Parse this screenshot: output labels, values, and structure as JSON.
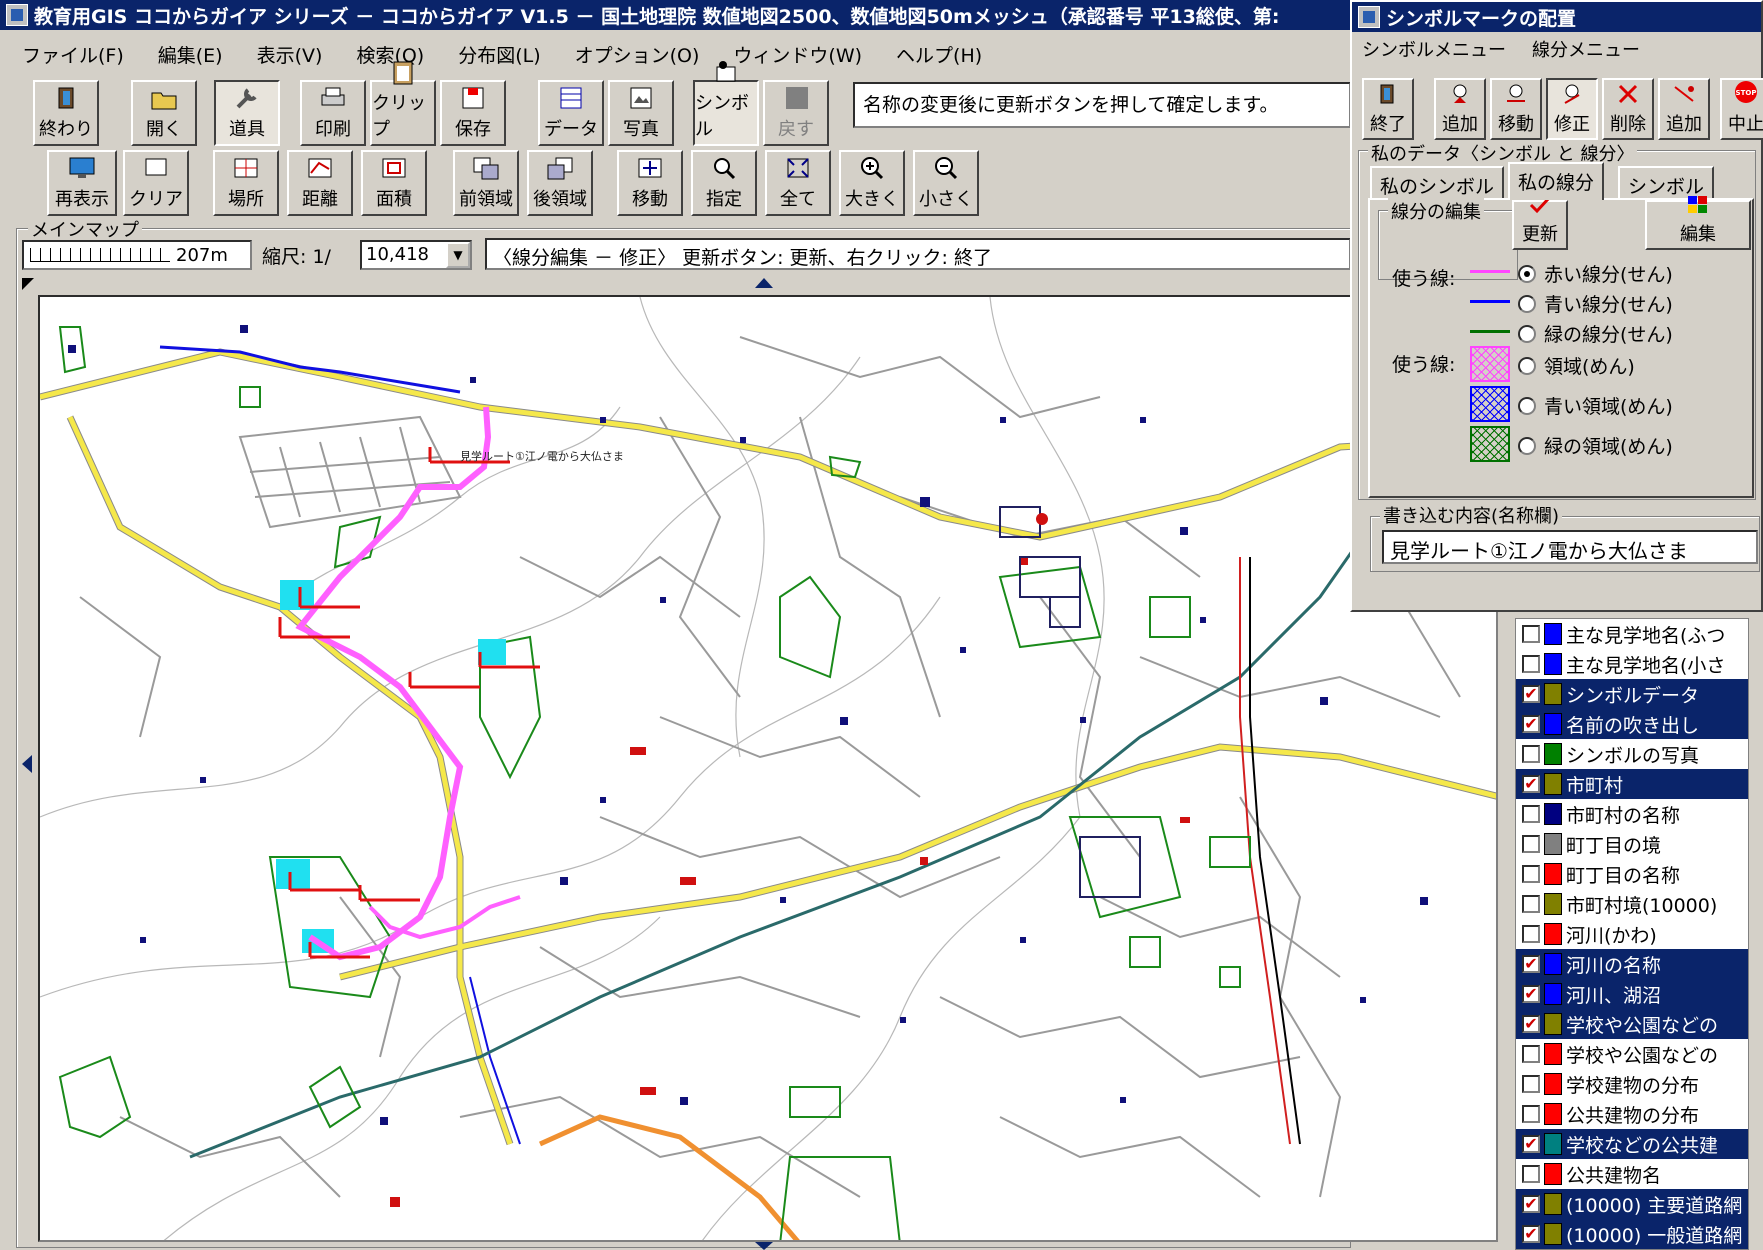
{
  "window": {
    "title": "教育用GIS ココからガイア シリーズ － ココからガイア V1.5 － 国土地理院 数値地図2500、数値地図50mメッシュ（承認番号 平13総使、第:"
  },
  "menu": {
    "items": [
      "ファイル(F)",
      "編集(E)",
      "表示(V)",
      "検索(Q)",
      "分布図(L)",
      "オプション(O)",
      "ウィンドウ(W)",
      "ヘルプ(H)"
    ]
  },
  "toolbar1": {
    "buttons": [
      {
        "label": "終わり",
        "icon": "exit-icon"
      },
      {
        "label": "開く",
        "icon": "open-folder-icon"
      },
      {
        "label": "道具",
        "icon": "tools-icon"
      },
      {
        "label": "印刷",
        "icon": "printer-icon"
      },
      {
        "label": "クリップ",
        "icon": "clipboard-icon"
      },
      {
        "label": "保存",
        "icon": "save-icon"
      },
      {
        "label": "データ",
        "icon": "data-icon"
      },
      {
        "label": "写真",
        "icon": "photo-icon"
      },
      {
        "label": "シンボル",
        "icon": "symbol-icon"
      },
      {
        "label": "戻す",
        "icon": "undo-icon"
      }
    ],
    "message": "名称の変更後に更新ボタンを押して確定します。"
  },
  "toolbar2": {
    "buttons": [
      {
        "label": "再表示",
        "icon": "redraw-icon"
      },
      {
        "label": "クリア",
        "icon": "clear-icon"
      },
      {
        "label": "場所",
        "icon": "location-icon"
      },
      {
        "label": "距離",
        "icon": "distance-icon"
      },
      {
        "label": "面積",
        "icon": "area-icon"
      },
      {
        "label": "前領域",
        "icon": "previous-extent-icon"
      },
      {
        "label": "後領域",
        "icon": "next-extent-icon"
      },
      {
        "label": "移動",
        "icon": "pan-icon"
      },
      {
        "label": "指定",
        "icon": "select-zoom-icon"
      },
      {
        "label": "全て",
        "icon": "full-extent-icon"
      },
      {
        "label": "大きく",
        "icon": "zoom-in-icon"
      },
      {
        "label": "小さく",
        "icon": "zoom-out-icon"
      }
    ]
  },
  "mainmap": {
    "group_label": "メインマップ",
    "scale_text": "207m",
    "scale_label": "縮尺: 1/",
    "scale_value": "10,418",
    "status": "〈線分編集 － 修正〉 更新ボタン: 更新、右クリック: 終了"
  },
  "dialog": {
    "title": "シンボルマークの配置",
    "menu": [
      "シンボルメニュー",
      "線分メニュー"
    ],
    "buttons": [
      {
        "label": "終了",
        "icon": "exit-icon"
      },
      {
        "label": "追加",
        "icon": "add-symbol-icon"
      },
      {
        "label": "移動",
        "icon": "move-symbol-icon"
      },
      {
        "label": "修正",
        "icon": "edit-symbol-icon"
      },
      {
        "label": "削除",
        "icon": "delete-symbol-icon"
      },
      {
        "label": "追加",
        "icon": "add-line-icon"
      },
      {
        "label": "中止",
        "icon": "stop-icon"
      }
    ],
    "data_group_label": "私のデータ〈シンボル と 線分〉",
    "tabs": [
      "私のシンボル",
      "私の線分",
      "シンボル"
    ],
    "active_tab": "私の線分",
    "edit_group_label": "線分の編集",
    "update_label": "更新",
    "edit_label": "編集",
    "use_line_label": "使う線:",
    "use_area_label": "使う線:",
    "line_options": [
      {
        "label": "赤い線分(せん)",
        "color": "#ff44ff",
        "checked": true
      },
      {
        "label": "青い線分(せん)",
        "color": "#0000ff",
        "checked": false
      },
      {
        "label": "緑の線分(せん)",
        "color": "#007000",
        "checked": false
      }
    ],
    "area_options": [
      {
        "label": "領域(めん)",
        "color": "#ff44ff",
        "checked": false
      },
      {
        "label": "青い領域(めん)",
        "color": "#0000ff",
        "checked": false
      },
      {
        "label": "緑の領域(めん)",
        "color": "#007000",
        "checked": false
      }
    ],
    "content_group_label": "書き込む内容(名称欄)",
    "content_value": "見学ルート①江ノ電から大仏さま"
  },
  "layers": [
    {
      "label": "主な見学地名(ふつ",
      "checked": false,
      "color": "#0000ff",
      "selected": false
    },
    {
      "label": "主な見学地名(小さ",
      "checked": false,
      "color": "#0000ff",
      "selected": false
    },
    {
      "label": "シンボルデータ",
      "checked": true,
      "color": "#808000",
      "selected": true
    },
    {
      "label": "名前の吹き出し",
      "checked": true,
      "color": "#0000ff",
      "selected": true
    },
    {
      "label": "シンボルの写真",
      "checked": false,
      "color": "#008000",
      "selected": false
    },
    {
      "label": "市町村",
      "checked": true,
      "color": "#808000",
      "selected": true
    },
    {
      "label": "市町村の名称",
      "checked": false,
      "color": "#000080",
      "selected": false
    },
    {
      "label": "町丁目の境",
      "checked": false,
      "color": "#808080",
      "selected": false
    },
    {
      "label": "町丁目の名称",
      "checked": false,
      "color": "#ff0000",
      "selected": false
    },
    {
      "label": "市町村境(10000)",
      "checked": false,
      "color": "#808000",
      "selected": false
    },
    {
      "label": "河川(かわ)",
      "checked": false,
      "color": "#ff0000",
      "selected": false
    },
    {
      "label": "河川の名称",
      "checked": true,
      "color": "#0000ff",
      "selected": true
    },
    {
      "label": "河川、湖沼",
      "checked": true,
      "color": "#0000ff",
      "selected": true
    },
    {
      "label": "学校や公園などの",
      "checked": true,
      "color": "#808000",
      "selected": true
    },
    {
      "label": "学校や公園などの",
      "checked": false,
      "color": "#ff0000",
      "selected": false
    },
    {
      "label": "学校建物の分布",
      "checked": false,
      "color": "#ff0000",
      "selected": false
    },
    {
      "label": "公共建物の分布",
      "checked": false,
      "color": "#ff0000",
      "selected": false
    },
    {
      "label": "学校などの公共建",
      "checked": true,
      "color": "#008080",
      "selected": true
    },
    {
      "label": "公共建物名",
      "checked": false,
      "color": "#ff0000",
      "selected": false
    },
    {
      "label": "(10000) 主要道路網",
      "checked": true,
      "color": "#808000",
      "selected": true
    },
    {
      "label": "(10000) 一般道路網",
      "checked": true,
      "color": "#808000",
      "selected": true
    }
  ],
  "map_labels": [
    "見学ルート①江ノ電から大仏さま"
  ]
}
